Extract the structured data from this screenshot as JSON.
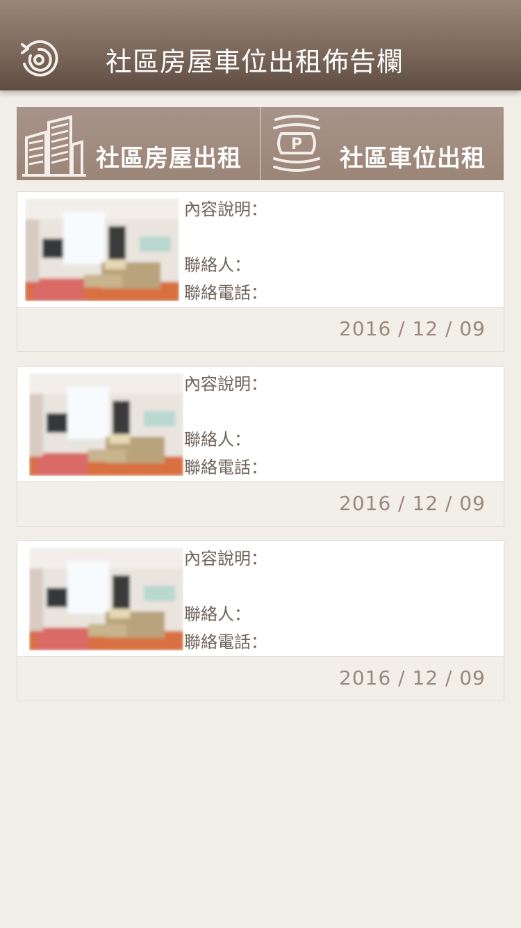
{
  "header": {
    "title": "社區房屋車位出租佈告欄",
    "back_icon": "refresh-back-icon"
  },
  "tabs": [
    {
      "label": "社區房屋出租",
      "icon": "buildings-icon"
    },
    {
      "label": "社區車位出租",
      "icon": "parking-building-icon"
    }
  ],
  "listings": [
    {
      "description_label": "內容說明：",
      "contact_label": "聯絡人：",
      "phone_label": "聯絡電話：",
      "date": "2016 / 12 / 09"
    },
    {
      "description_label": "內容說明：",
      "contact_label": "聯絡人：",
      "phone_label": "聯絡電話：",
      "date": "2016 / 12 / 09"
    },
    {
      "description_label": "內容說明：",
      "contact_label": "聯絡人：",
      "phone_label": "聯絡電話：",
      "date": "2016 / 12 / 09"
    }
  ],
  "colors": {
    "header_top": "#9b8779",
    "header_bottom": "#5f4d42",
    "tab_background": "#a18c7d",
    "page_background": "#f1eee8",
    "label_text": "#6f6259",
    "date_text": "#9a887d"
  }
}
